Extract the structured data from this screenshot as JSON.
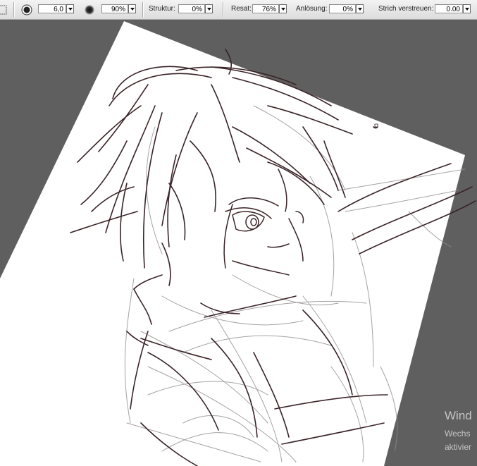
{
  "toolbar": {
    "brush_size": "6,0",
    "opacity": "90%",
    "structure_label": "Struktur:",
    "structure_value": "0%",
    "resat_label": "Resat:",
    "resat_value": "76%",
    "dissolve_label": "Anlösung:",
    "dissolve_value": "0%",
    "scatter_label": "Strich verstreuen:",
    "scatter_value": "0.00"
  },
  "watermark": {
    "line1": "Wind",
    "line2": "Wechs",
    "line3": "aktivier"
  },
  "colors": {
    "toolbar_bg": "#e6e6e6",
    "workspace_bg": "#5f5f5f",
    "paper": "#ffffff",
    "ink": "#3b2428",
    "sketch_grey": "#8f8b8c"
  },
  "icons": [
    "brush-preset-icon",
    "brush-tip-icon",
    "hardness-icon",
    "dropdown-arrow-icon"
  ]
}
